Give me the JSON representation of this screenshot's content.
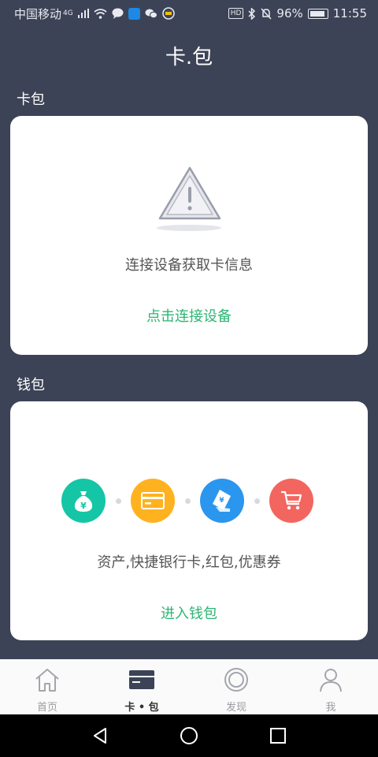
{
  "status_bar": {
    "carrier": "中国移动",
    "network": "4G",
    "battery_percent": "96%",
    "time": "11:55",
    "hd_label": "HD"
  },
  "header": {
    "title": "卡.包"
  },
  "card_section": {
    "title": "卡包",
    "message": "连接设备获取卡信息",
    "action": "点击连接设备",
    "icon": "warning-triangle-icon"
  },
  "wallet_section": {
    "title": "钱包",
    "description": "资产,快捷银行卡,红包,优惠券",
    "action": "进入钱包",
    "icons": [
      {
        "name": "money-bag-icon",
        "color": "#14c6a5"
      },
      {
        "name": "bank-card-icon",
        "color": "#ffb21f"
      },
      {
        "name": "red-packet-icon",
        "color": "#2b96ee"
      },
      {
        "name": "shopping-cart-icon",
        "color": "#f2665f"
      }
    ]
  },
  "bottom_nav": {
    "items": [
      {
        "label": "首页",
        "icon": "home-icon",
        "active": false
      },
      {
        "label": "卡 • 包",
        "icon": "card-icon",
        "active": true
      },
      {
        "label": "发现",
        "icon": "discover-icon",
        "active": false
      },
      {
        "label": "我",
        "icon": "profile-icon",
        "active": false
      }
    ]
  },
  "colors": {
    "background": "#3d4356",
    "accent_green": "#2bb673"
  }
}
